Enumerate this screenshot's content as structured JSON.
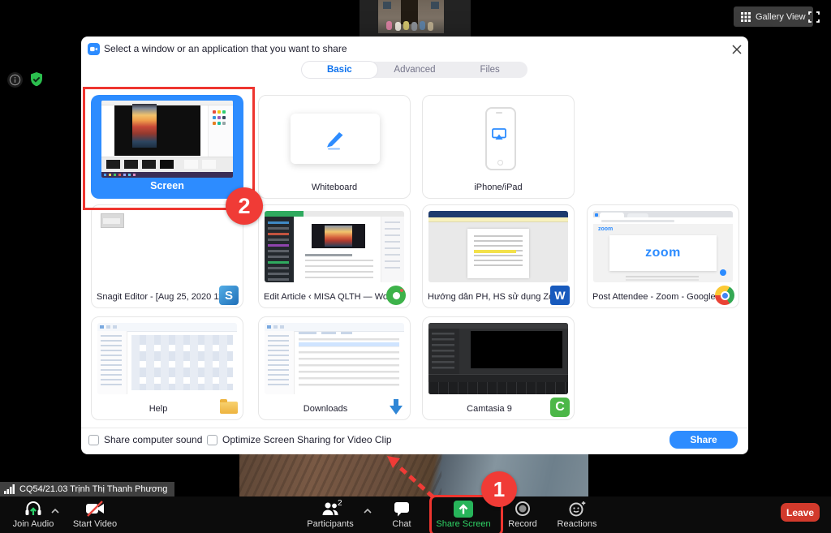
{
  "top_bar": {
    "gallery_view_label": "Gallery View"
  },
  "dialog": {
    "title": "Select a window or an application that you want to share",
    "tabs": {
      "basic": "Basic",
      "advanced": "Advanced",
      "files": "Files"
    },
    "tiles": {
      "screen": "Screen",
      "whiteboard": "Whiteboard",
      "iphone": "iPhone/iPad",
      "snagit": "Snagit Editor - [Aug 25, 2020 11:3...",
      "edit_article": "Edit Article ‹ MISA QLTH — Word...",
      "word_doc": "Hướng dẫn PH, HS sử dụng Zoo...",
      "post_attendee": "Post Attendee - Zoom - Google ...",
      "help": "Help",
      "downloads": "Downloads",
      "camtasia": "Camtasia 9"
    },
    "thumbs": {
      "post_attendee_logo": "zoom",
      "post_attendee_small_logo": "zoom"
    },
    "badges": {
      "snagit": "S",
      "word": "W",
      "camtasia": "C"
    },
    "footer": {
      "share_sound": "Share computer sound",
      "optimize": "Optimize Screen Sharing for Video Clip",
      "share_button": "Share"
    },
    "checkboxes_checked": {
      "share_sound": false,
      "optimize": false
    }
  },
  "annotations": {
    "step_1": "1",
    "step_2": "2"
  },
  "status": {
    "participant_name": "CQ54/21.03 Trịnh Thị Thanh Phương"
  },
  "toolbar": {
    "join_audio": "Join Audio",
    "start_video": "Start Video",
    "participants": "Participants",
    "participants_count": "2",
    "chat": "Chat",
    "share_screen": "Share Screen",
    "record": "Record",
    "reactions": "Reactions",
    "leave": "Leave"
  },
  "colors": {
    "accent_blue": "#2D8CFF",
    "tab_active_blue": "#0E72ED",
    "annotation_red": "#F03B36",
    "leave_red": "#D23A2C",
    "share_green": "#2FD566"
  }
}
